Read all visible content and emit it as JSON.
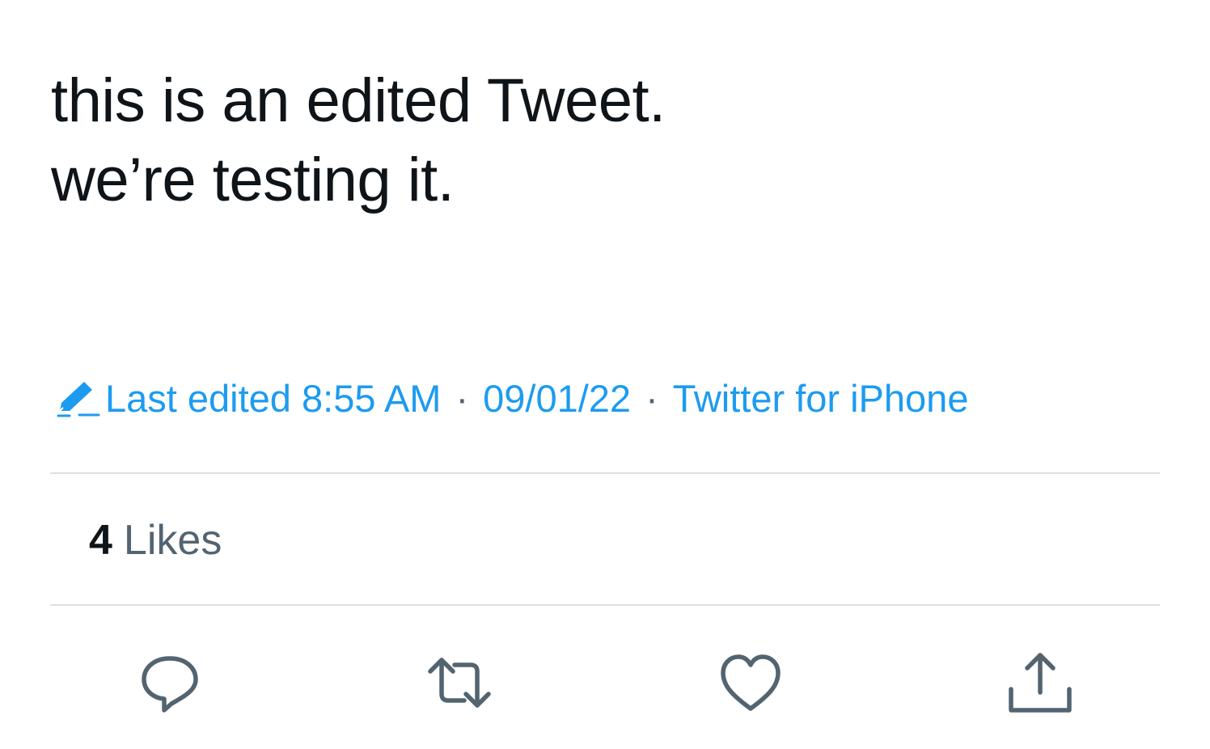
{
  "tweet": {
    "text_lines": [
      "this is an edited Tweet.",
      "we’re testing it."
    ],
    "meta": {
      "edited_label": "Last edited",
      "time": "8:55 AM",
      "date": "09/01/22",
      "separator": "·",
      "source": "Twitter for iPhone"
    },
    "likes": {
      "count": "4",
      "label": "Likes"
    },
    "actions": {
      "reply_icon": "reply-icon",
      "retweet_icon": "retweet-icon",
      "like_icon": "heart-icon",
      "share_icon": "share-icon"
    }
  },
  "colors": {
    "text": "#0f1419",
    "accent": "#1d9bf0",
    "secondary": "#536471",
    "divider": "#dcdfe2"
  }
}
